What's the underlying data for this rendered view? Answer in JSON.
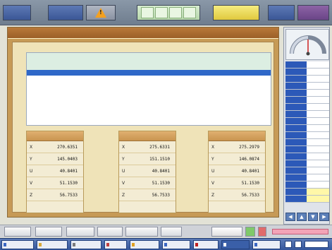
{
  "toolbar": {
    "buttons": [
      {
        "label": "",
        "style": "blue"
      },
      {
        "label": "",
        "style": "blue"
      },
      {
        "label": "",
        "style": "grey"
      },
      {
        "label": "",
        "style": "grey"
      },
      {
        "label": "",
        "style": "yellow"
      },
      {
        "label": "",
        "style": "blue"
      },
      {
        "label": "",
        "style": "purple"
      }
    ],
    "warning_icon": "warning-triangle-icon",
    "segments": [
      "",
      "",
      "",
      ""
    ]
  },
  "dialog": {
    "title": "",
    "list": [
      {
        "c1": "",
        "c2": "",
        "c3": "",
        "selected": false
      },
      {
        "c1": "",
        "c2": "",
        "c3": "",
        "selected": false
      },
      {
        "c1": "",
        "c2": "",
        "c3": "",
        "selected": false
      },
      {
        "c1": "",
        "c2": "",
        "c3": "",
        "selected": true
      }
    ],
    "panels": [
      {
        "title": "",
        "rows": [
          {
            "axis": "X",
            "value": "270.6351"
          },
          {
            "axis": "Y",
            "value": "145.0403"
          },
          {
            "axis": "U",
            "value": "40.8401"
          },
          {
            "axis": "V",
            "value": "51.1530"
          },
          {
            "axis": "Z",
            "value": "56.7533"
          }
        ]
      },
      {
        "title": "",
        "rows": [
          {
            "axis": "X",
            "value": "275.6331"
          },
          {
            "axis": "Y",
            "value": "151.1510"
          },
          {
            "axis": "U",
            "value": "40.8401"
          },
          {
            "axis": "V",
            "value": "51.1530"
          },
          {
            "axis": "Z",
            "value": "56.7533"
          }
        ]
      },
      {
        "title": "",
        "rows": [
          {
            "axis": "X",
            "value": "275.2979"
          },
          {
            "axis": "Y",
            "value": "146.0874"
          },
          {
            "axis": "U",
            "value": "40.8401"
          },
          {
            "axis": "V",
            "value": "51.1530"
          },
          {
            "axis": "Z",
            "value": "56.7533"
          }
        ]
      }
    ]
  },
  "side": {
    "gauge_label": "",
    "gauge_level": 0.5,
    "params": [
      {
        "k": "",
        "v": "",
        "hl": false
      },
      {
        "k": "",
        "v": "",
        "hl": false
      },
      {
        "k": "",
        "v": "",
        "hl": false
      },
      {
        "k": "",
        "v": "",
        "hl": false
      },
      {
        "k": "",
        "v": "",
        "hl": false
      },
      {
        "k": "",
        "v": "",
        "hl": false
      },
      {
        "k": "",
        "v": "",
        "hl": false
      },
      {
        "k": "",
        "v": "",
        "hl": false
      },
      {
        "k": "",
        "v": "",
        "hl": false
      },
      {
        "k": "",
        "v": "",
        "hl": false
      },
      {
        "k": "",
        "v": "",
        "hl": false
      },
      {
        "k": "",
        "v": "",
        "hl": false
      },
      {
        "k": "",
        "v": "",
        "hl": false
      },
      {
        "k": "",
        "v": "",
        "hl": false
      },
      {
        "k": "",
        "v": "",
        "hl": false
      },
      {
        "k": "",
        "v": "",
        "hl": false
      },
      {
        "k": "",
        "v": "",
        "hl": false
      },
      {
        "k": "",
        "v": "",
        "hl": false
      },
      {
        "k": "",
        "v": "",
        "hl": true
      },
      {
        "k": "",
        "v": "",
        "hl": true
      }
    ],
    "arrows": [
      "◀",
      "▲",
      "▼",
      "▶"
    ]
  },
  "buttonbar": {
    "buttons": [
      "",
      "",
      "",
      "",
      "",
      ""
    ],
    "mode_label": ""
  },
  "taskbar": {
    "items": [
      "",
      "",
      "",
      "",
      "",
      "",
      "",
      "",
      ""
    ]
  },
  "colors": {
    "accent_blue": "#2f68c8",
    "title_brown": "#9c5f27",
    "panel_head": "#c99450",
    "alert": "#d33"
  }
}
